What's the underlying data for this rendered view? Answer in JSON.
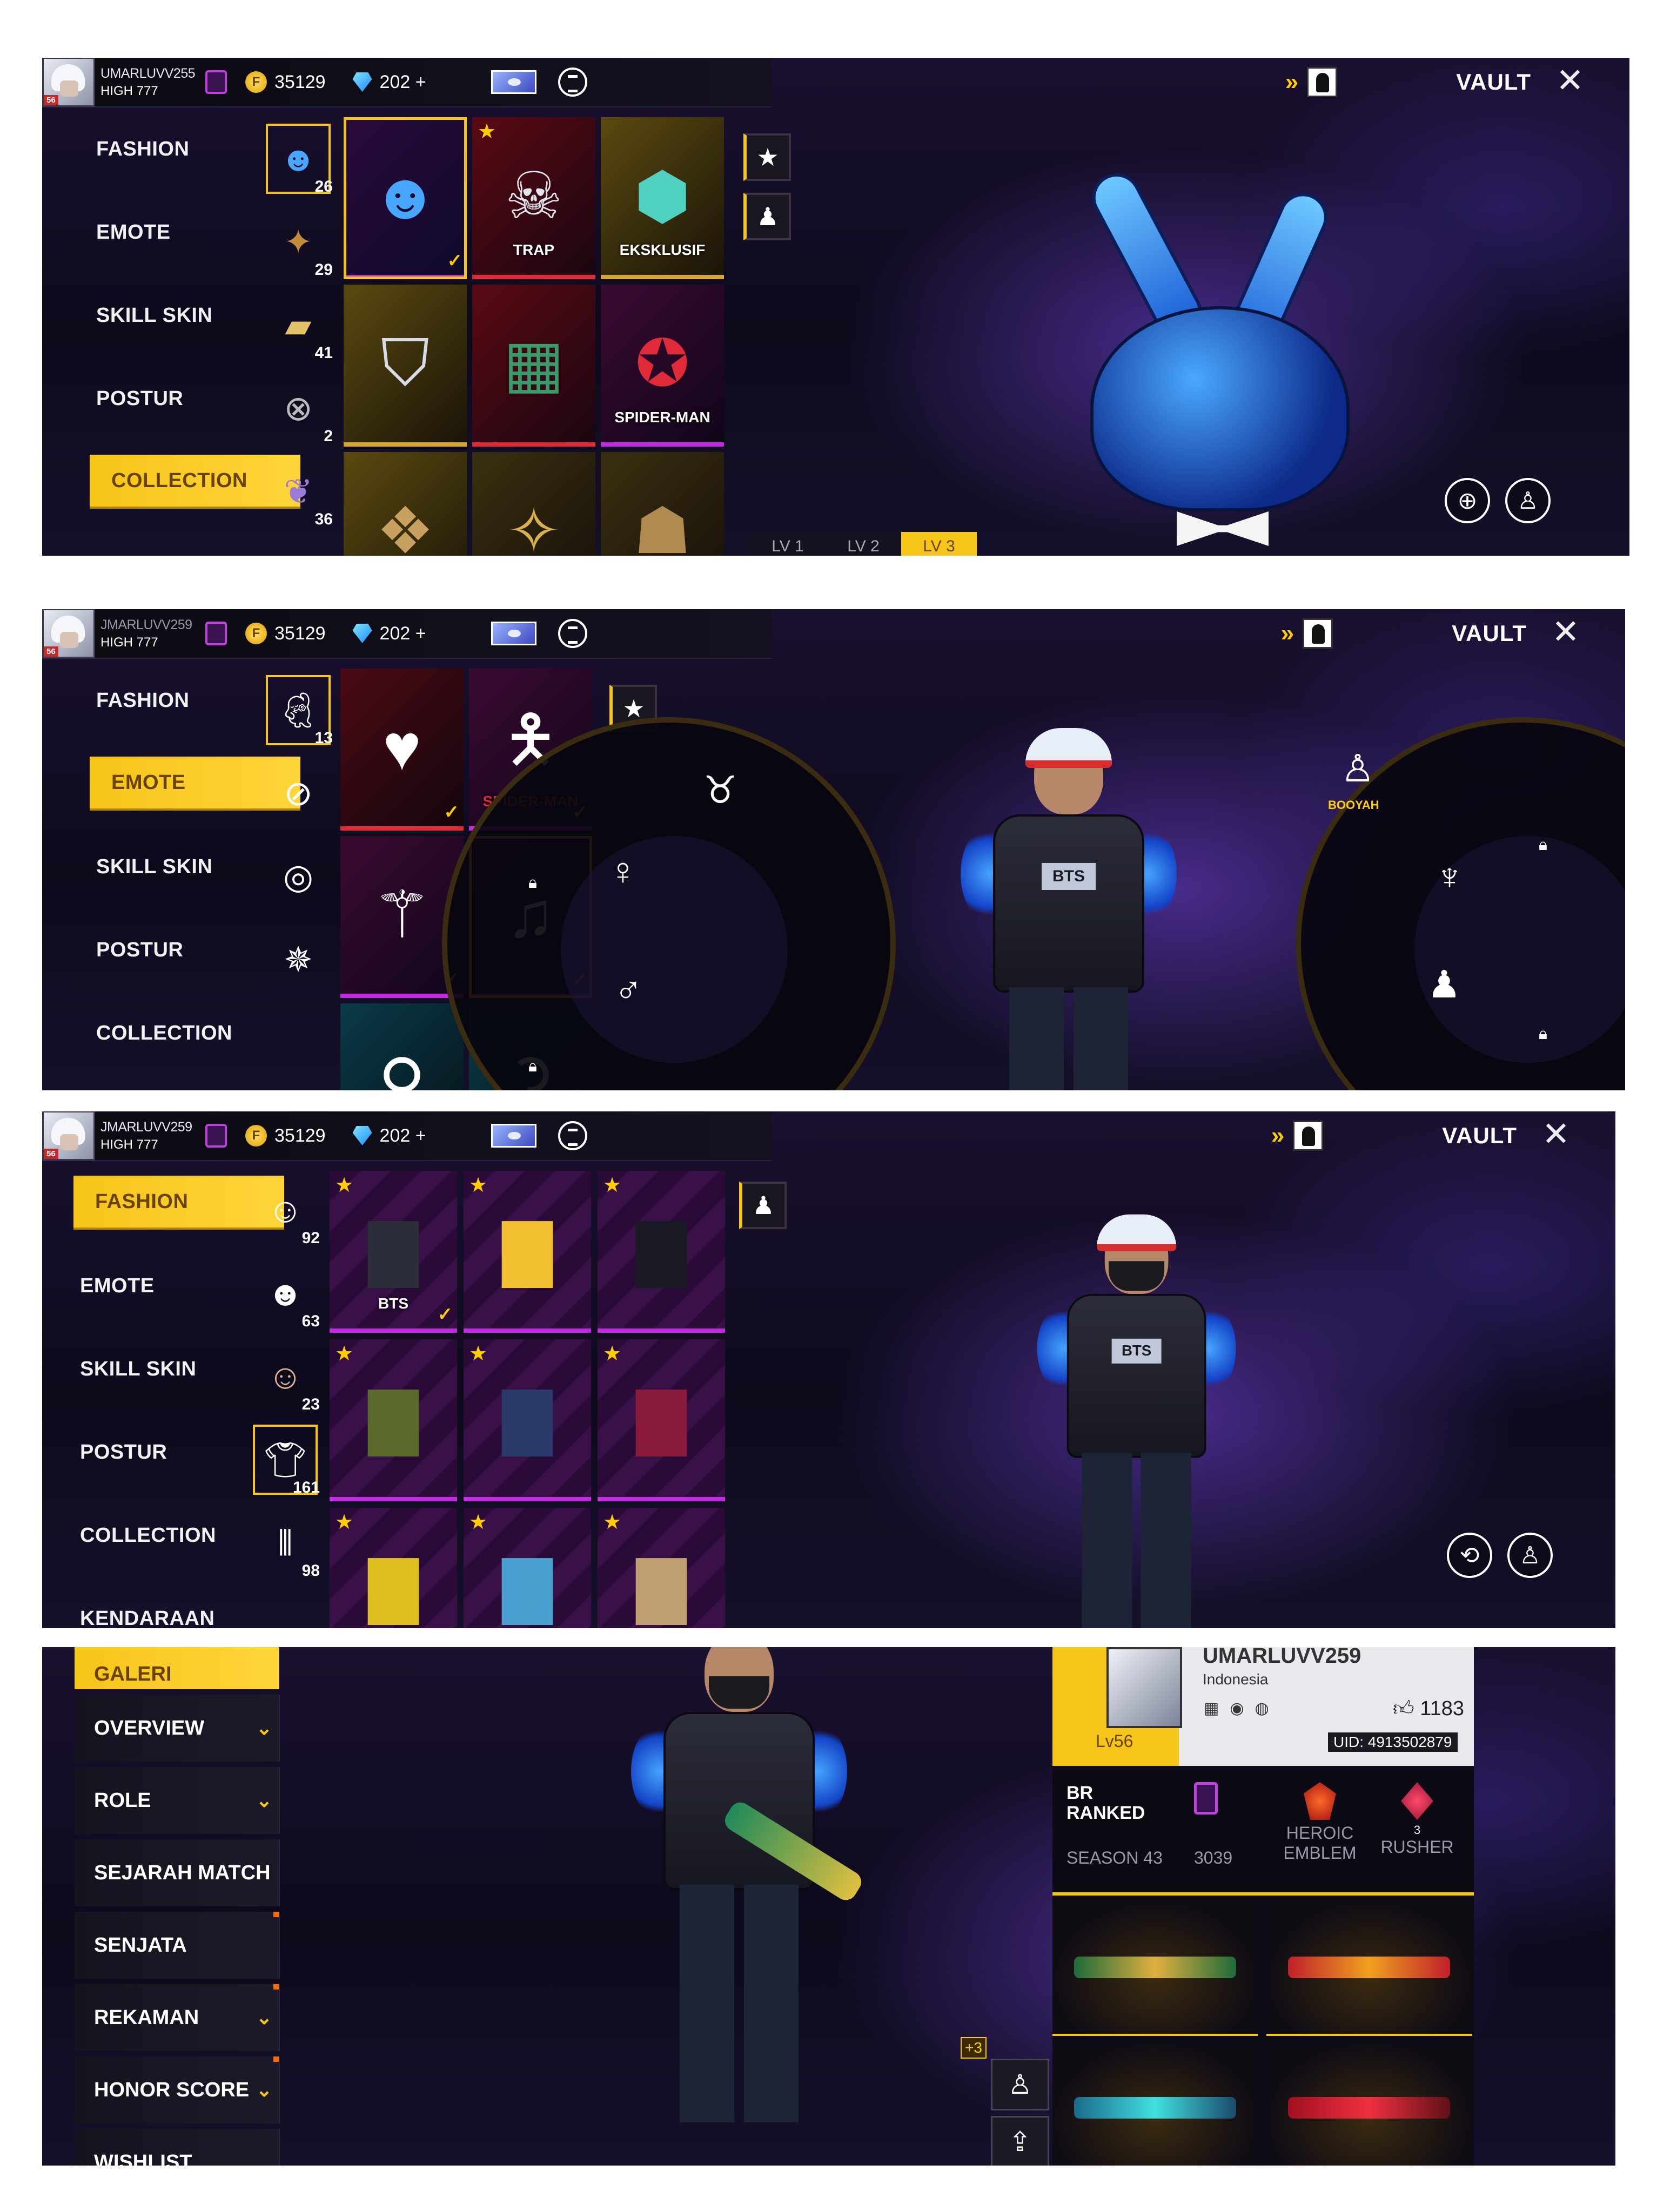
{
  "topbar": {
    "username_1": "UMARLUVV255",
    "username_2": "JMARLUVV259",
    "username_3": "JMARLUVV259",
    "rank_label": "HIGH",
    "rank_value": "777",
    "gold_amount": "35129",
    "diamond_amount": "202 +",
    "coin_symbol": "F",
    "vault_label": "VAULT",
    "close_symbol": "✕",
    "expand_symbol": "»",
    "level_badge": "56"
  },
  "menu": [
    "FASHION",
    "EMOTE",
    "SKILL SKIN",
    "POSTUR",
    "COLLECTION"
  ],
  "menu3": [
    "FASHION",
    "EMOTE",
    "SKILL SKIN",
    "POSTUR",
    "COLLECTION",
    "KENDARAAN"
  ],
  "panel1": {
    "active_menu": "COLLECTION",
    "icon_counts": [
      "26",
      "29",
      "41",
      "2",
      "36"
    ],
    "tiles": [
      {
        "label": ""
      },
      {
        "label": "TRAP"
      },
      {
        "label": "EKSKLUSIF"
      },
      {
        "label": ""
      },
      {
        "label": ""
      },
      {
        "label": "SPIDER-MAN"
      },
      {
        "label": ""
      },
      {
        "label": ""
      },
      {
        "label": ""
      }
    ],
    "level_tabs": [
      "LV 1",
      "LV 2",
      "LV 3"
    ],
    "icons": {
      "star": "star-icon",
      "outfit": "outfit-icon",
      "zoom": "zoom-in-icon",
      "person": "character-icon"
    }
  },
  "panel2": {
    "active_menu": "EMOTE",
    "icon_counts": [
      "13"
    ],
    "tile_labels": [
      "",
      "SPIDER-MAN",
      "",
      "",
      "",
      ""
    ],
    "booyah_label": "BOOYAH"
  },
  "panel3": {
    "active_menu": "FASHION",
    "icon_counts": [
      "92",
      "63",
      "23",
      "161",
      "98"
    ],
    "tile_labels": [
      "BTS",
      "",
      "",
      "",
      "",
      "",
      "",
      "",
      ""
    ]
  },
  "panel4": {
    "menu": [
      {
        "label": "GALERI",
        "arrow": ""
      },
      {
        "label": "OVERVIEW",
        "arrow": "⌄"
      },
      {
        "label": "ROLE",
        "arrow": "⌄"
      },
      {
        "label": "SEJARAH MATCH",
        "arrow": ""
      },
      {
        "label": "SENJATA",
        "arrow": ""
      },
      {
        "label": "REKAMAN",
        "arrow": "⌄"
      },
      {
        "label": "HONOR SCORE",
        "arrow": "⌄"
      },
      {
        "label": "WISHLIST",
        "arrow": ""
      }
    ],
    "profile": {
      "name": "UMARLUVV259",
      "country": "Indonesia",
      "level": "Lv56",
      "likes": "1183",
      "uid": "UID: 4913502879",
      "br_title_1": "BR",
      "br_title_2": "RANKED",
      "season": "SEASON 43",
      "points": "3039",
      "emblem_1": "HEROIC",
      "emblem_2": "EMBLEM",
      "rusher": "RUSHER",
      "rusher_level": "3"
    },
    "plus_badge": "+3"
  },
  "colors": {
    "accent": "#f6c51a",
    "purple": "#c22ae0",
    "bg": "#120d24"
  }
}
